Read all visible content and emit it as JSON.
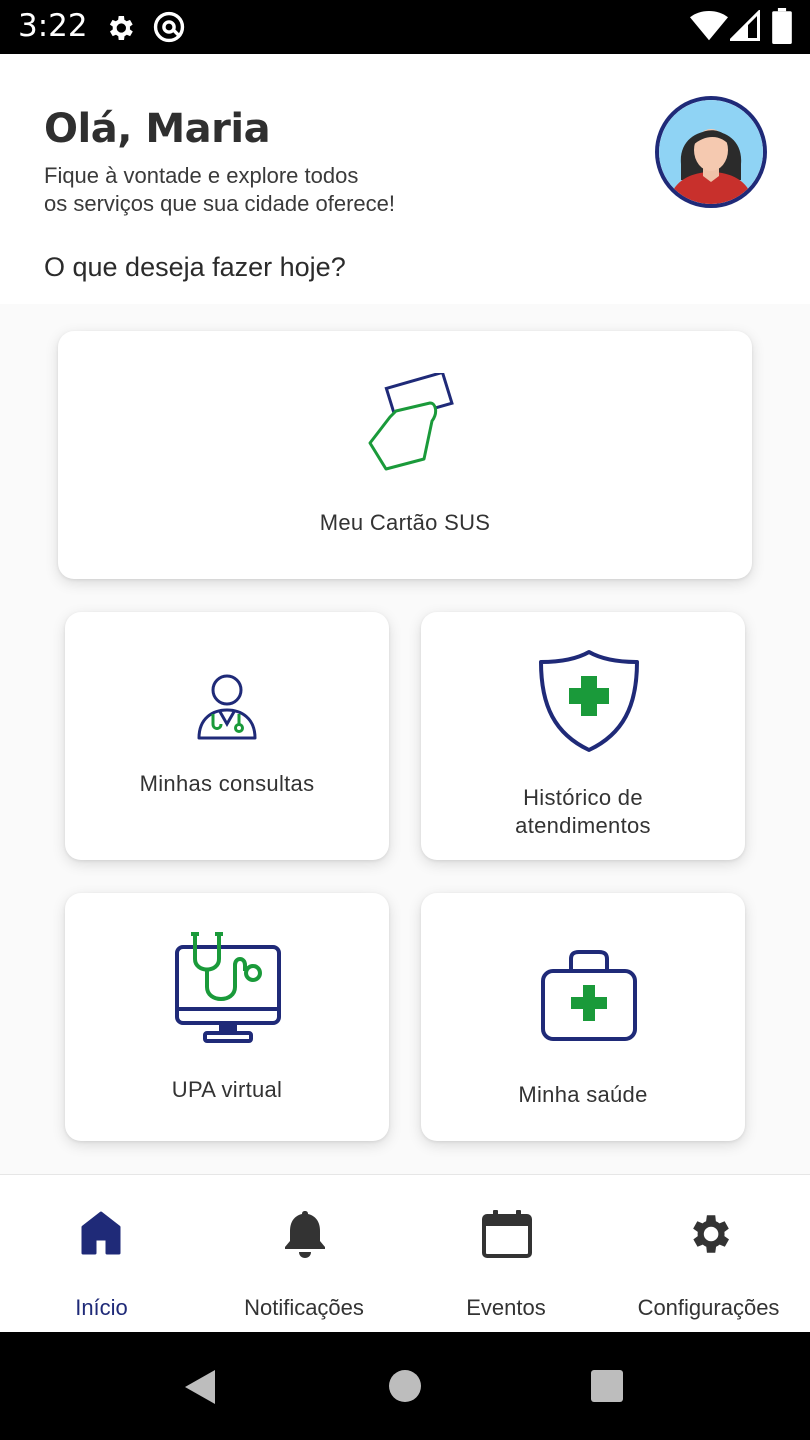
{
  "status_bar": {
    "time": "3:22",
    "icons": [
      "settings-icon",
      "at-sign-icon",
      "wifi-icon",
      "signal-icon",
      "battery-icon"
    ]
  },
  "header": {
    "greeting": "Olá, Maria",
    "subtitle_line1": "Fique à vontade e explore todos",
    "subtitle_line2": "os serviços que sua cidade oferece!",
    "question": "O que deseja fazer hoje?"
  },
  "cards": {
    "cartao_sus": "Meu Cartão SUS",
    "consultas": "Minhas consultas",
    "historico_line1": "Histórico de",
    "historico_line2": "atendimentos",
    "upa": "UPA virtual",
    "saude": "Minha saúde"
  },
  "bottom_nav": {
    "items": [
      {
        "label": "Início",
        "icon": "home-icon",
        "active": true
      },
      {
        "label": "Notificações",
        "icon": "bell-icon",
        "active": false
      },
      {
        "label": "Eventos",
        "icon": "calendar-icon",
        "active": false
      },
      {
        "label": "Configurações",
        "icon": "gear-icon",
        "active": false
      }
    ]
  },
  "colors": {
    "navy": "#1f2a78",
    "green": "#1a9a3a",
    "active_nav": "#1f2a78"
  }
}
